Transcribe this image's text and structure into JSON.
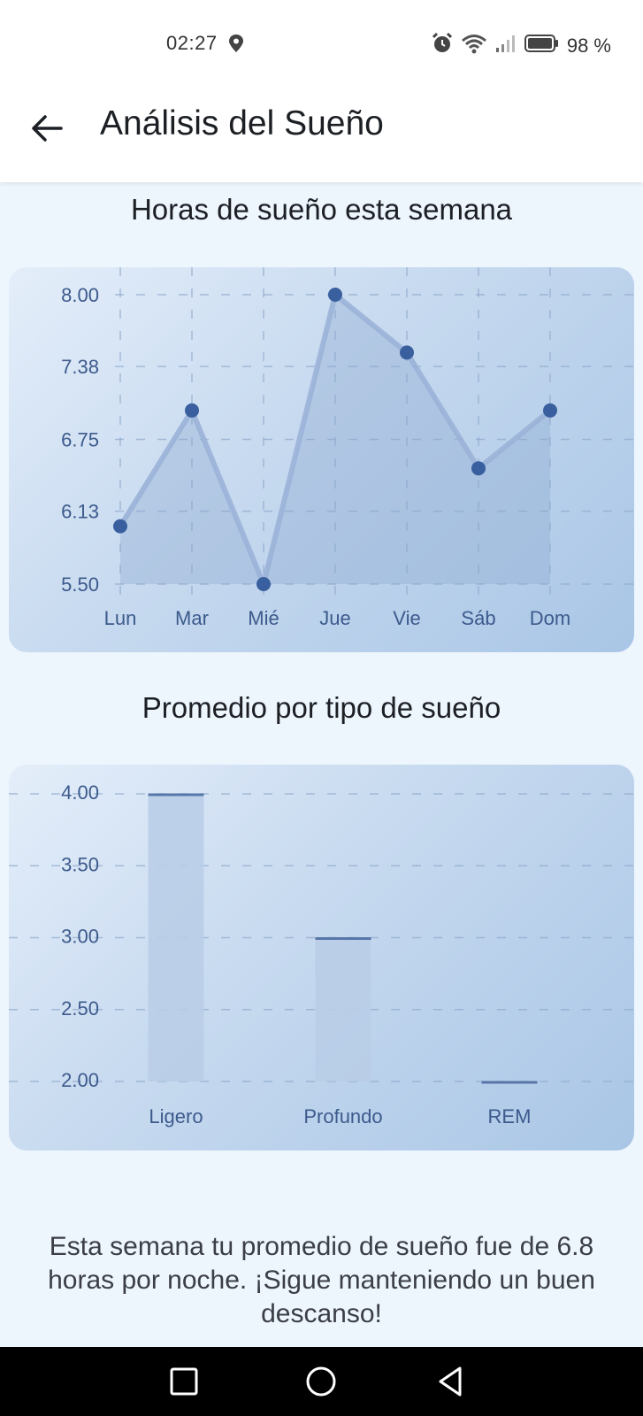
{
  "status_bar": {
    "time": "02:27",
    "battery": "98 %"
  },
  "app_bar": {
    "title": "Análisis del Sueño",
    "back_icon": "arrow-left-icon"
  },
  "weekly_chart": {
    "title": "Horas de sueño esta semana",
    "chart_data": {
      "type": "line",
      "categories": [
        "Lun",
        "Mar",
        "Mié",
        "Jue",
        "Vie",
        "Sáb",
        "Dom"
      ],
      "values": [
        6.0,
        7.0,
        5.5,
        8.0,
        7.5,
        6.5,
        7.0
      ],
      "yticks": [
        "8.00",
        "7.38",
        "6.75",
        "6.13",
        "5.50"
      ],
      "ylim": [
        5.5,
        8.0
      ],
      "grid": true,
      "filled": true,
      "color": "#3a5f9e",
      "title": "",
      "xlabel": "",
      "ylabel": ""
    }
  },
  "type_chart": {
    "title": "Promedio por tipo de sueño",
    "chart_data": {
      "type": "bar",
      "categories": [
        "Ligero",
        "Profundo",
        "REM"
      ],
      "values": [
        4.0,
        3.0,
        2.0
      ],
      "yticks": [
        "4.00",
        "3.50",
        "3.00",
        "2.50",
        "2.00"
      ],
      "ylim": [
        2.0,
        4.0
      ],
      "grid": true,
      "color": "#b8cde6",
      "accent": "#5877a8",
      "title": "",
      "xlabel": "",
      "ylabel": ""
    }
  },
  "summary": "Esta semana tu promedio de sueño fue de 6.8 horas por noche. ¡Sigue manteniendo un buen descanso!"
}
